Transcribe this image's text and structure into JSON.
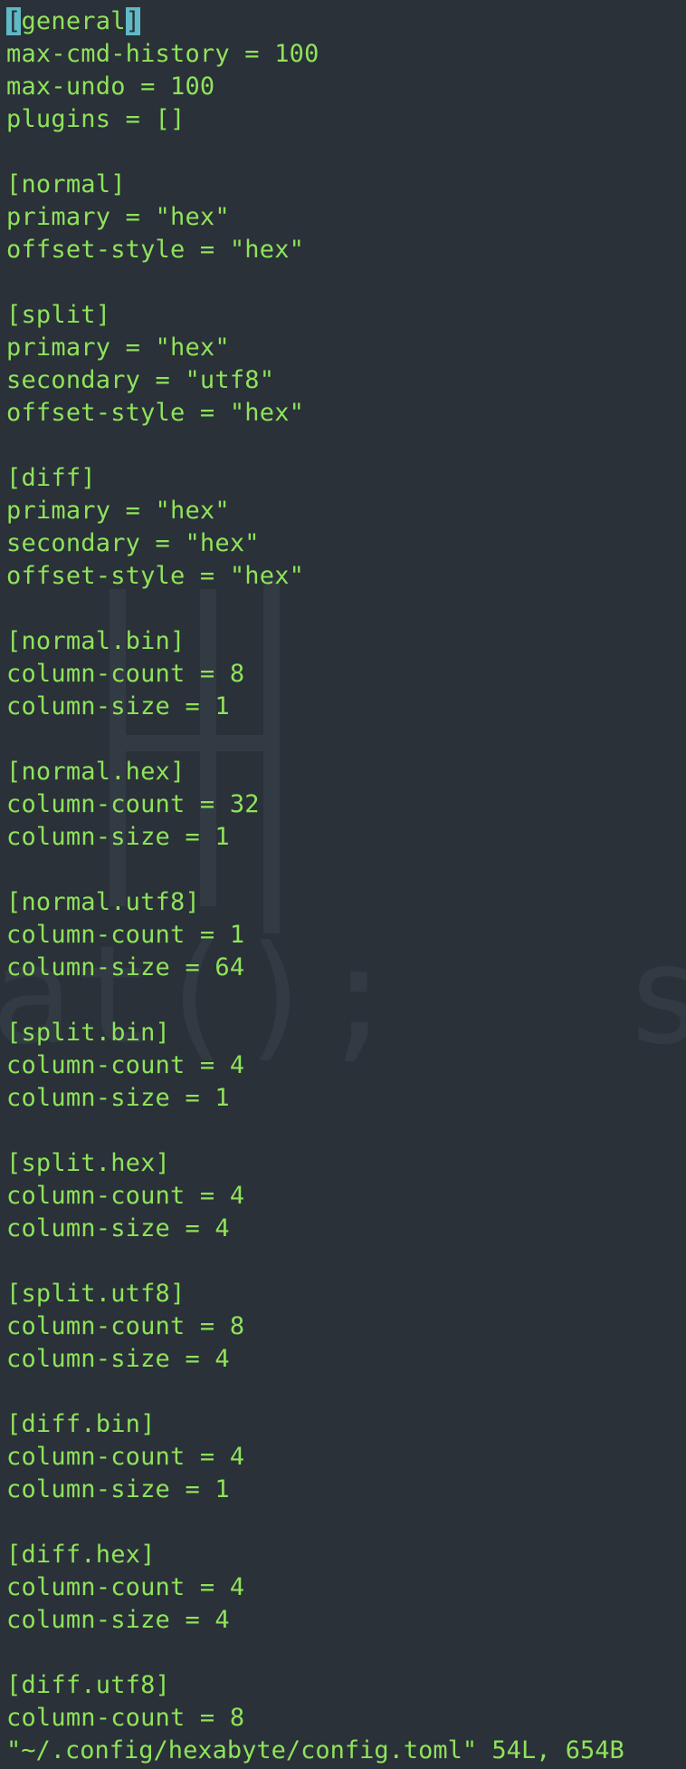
{
  "editor": {
    "cursor": "[",
    "first_line_rest": "general",
    "cursor_end": "]",
    "lines": [
      "max-cmd-history = 100",
      "max-undo = 100",
      "plugins = []",
      "",
      "[normal]",
      "primary = \"hex\"",
      "offset-style = \"hex\"",
      "",
      "[split]",
      "primary = \"hex\"",
      "secondary = \"utf8\"",
      "offset-style = \"hex\"",
      "",
      "[diff]",
      "primary = \"hex\"",
      "secondary = \"hex\"",
      "offset-style = \"hex\"",
      "",
      "[normal.bin]",
      "column-count = 8",
      "column-size = 1",
      "",
      "[normal.hex]",
      "column-count = 32",
      "column-size = 1",
      "",
      "[normal.utf8]",
      "column-count = 1",
      "column-size = 64",
      "",
      "[split.bin]",
      "column-count = 4",
      "column-size = 1",
      "",
      "[split.hex]",
      "column-count = 4",
      "column-size = 4",
      "",
      "[split.utf8]",
      "column-count = 8",
      "column-size = 4",
      "",
      "[diff.bin]",
      "column-count = 4",
      "column-size = 1",
      "",
      "[diff.hex]",
      "column-count = 4",
      "column-size = 4",
      "",
      "[diff.utf8]",
      "column-count = 8"
    ]
  },
  "status_line": "\"~/.config/hexabyte/config.toml\" 54L, 654B",
  "colors": {
    "background": "#2a3139",
    "text": "#8fe35a",
    "cursor": "#5fb9c6"
  }
}
